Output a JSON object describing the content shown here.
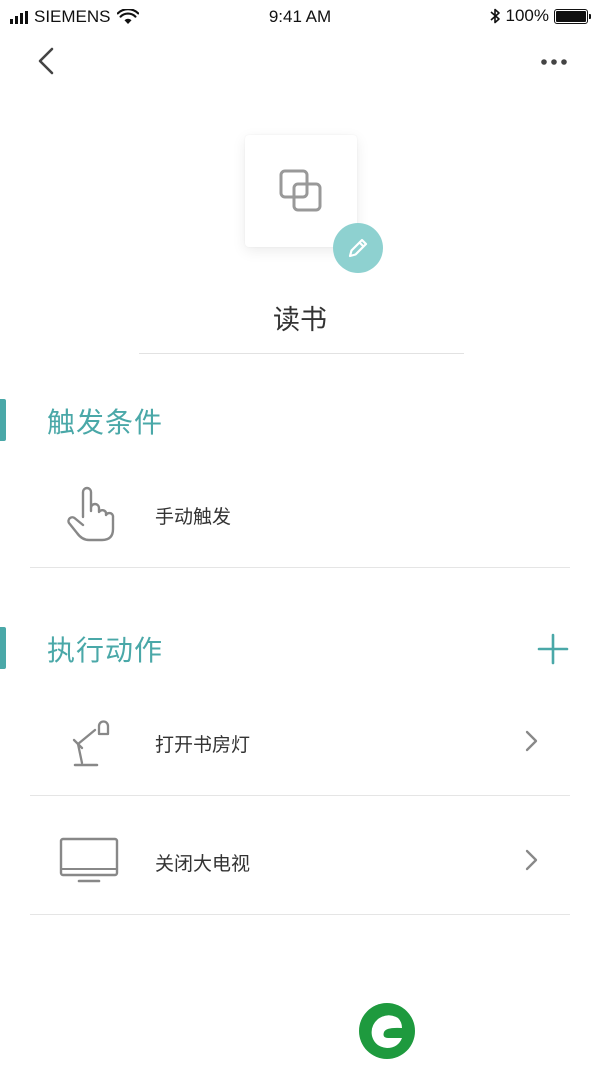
{
  "status_bar": {
    "carrier": "SIEMENS",
    "time": "9:41 AM",
    "battery": "100%"
  },
  "nav": {
    "back_icon": "chevron-left-icon",
    "more_icon": "more-dots-icon"
  },
  "scene": {
    "icon": "overlapping-squares-icon",
    "edit_icon": "pencil-icon",
    "name": "读书"
  },
  "trigger_section": {
    "title": "触发条件",
    "items": [
      {
        "icon": "hand-pointer-icon",
        "label": "手动触发"
      }
    ]
  },
  "action_section": {
    "title": "执行动作",
    "add_icon": "plus-icon",
    "items": [
      {
        "icon": "desk-lamp-icon",
        "label": "打开书房灯"
      },
      {
        "icon": "tv-icon",
        "label": "关闭大电视"
      }
    ]
  },
  "colors": {
    "accent": "#4aa8a8",
    "edit_badge": "#8ed1d0",
    "logo_green": "#1e9a3e"
  }
}
